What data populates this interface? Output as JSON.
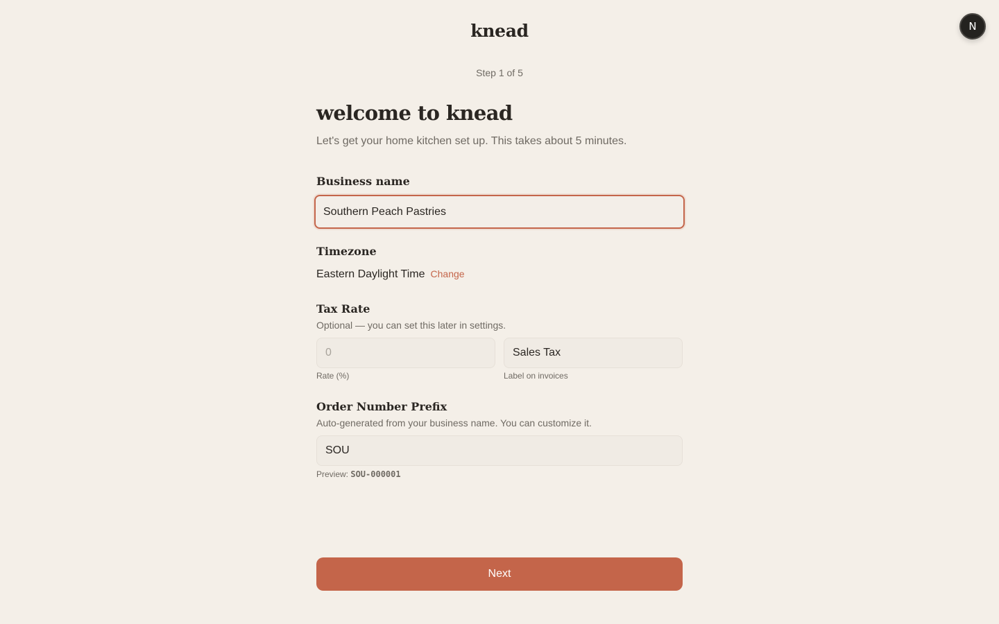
{
  "app": {
    "logo": "knead",
    "avatar_initial": "N",
    "step": "Step 1 of 5"
  },
  "header": {
    "title": "welcome to knead",
    "subtitle": "Let's get your home kitchen set up. This takes about 5 minutes."
  },
  "business_name": {
    "label": "Business name",
    "value": "Southern Peach Pastries"
  },
  "timezone": {
    "label": "Timezone",
    "value": "Eastern Daylight Time",
    "change_label": "Change"
  },
  "tax_rate": {
    "label": "Tax Rate",
    "help": "Optional — you can set this later in settings.",
    "rate_placeholder": "0",
    "rate_value": "",
    "rate_caption": "Rate (%)",
    "tax_label_value": "Sales Tax",
    "tax_label_caption": "Label on invoices"
  },
  "order_prefix": {
    "label": "Order Number Prefix",
    "help": "Auto-generated from your business name. You can customize it.",
    "value": "SOU",
    "preview_label": "Preview:",
    "preview_value": "SOU-000001"
  },
  "actions": {
    "next_label": "Next"
  },
  "colors": {
    "background": "#f4efe8",
    "accent": "#c4654a",
    "text": "#2a2622",
    "muted": "#6f6a63"
  }
}
